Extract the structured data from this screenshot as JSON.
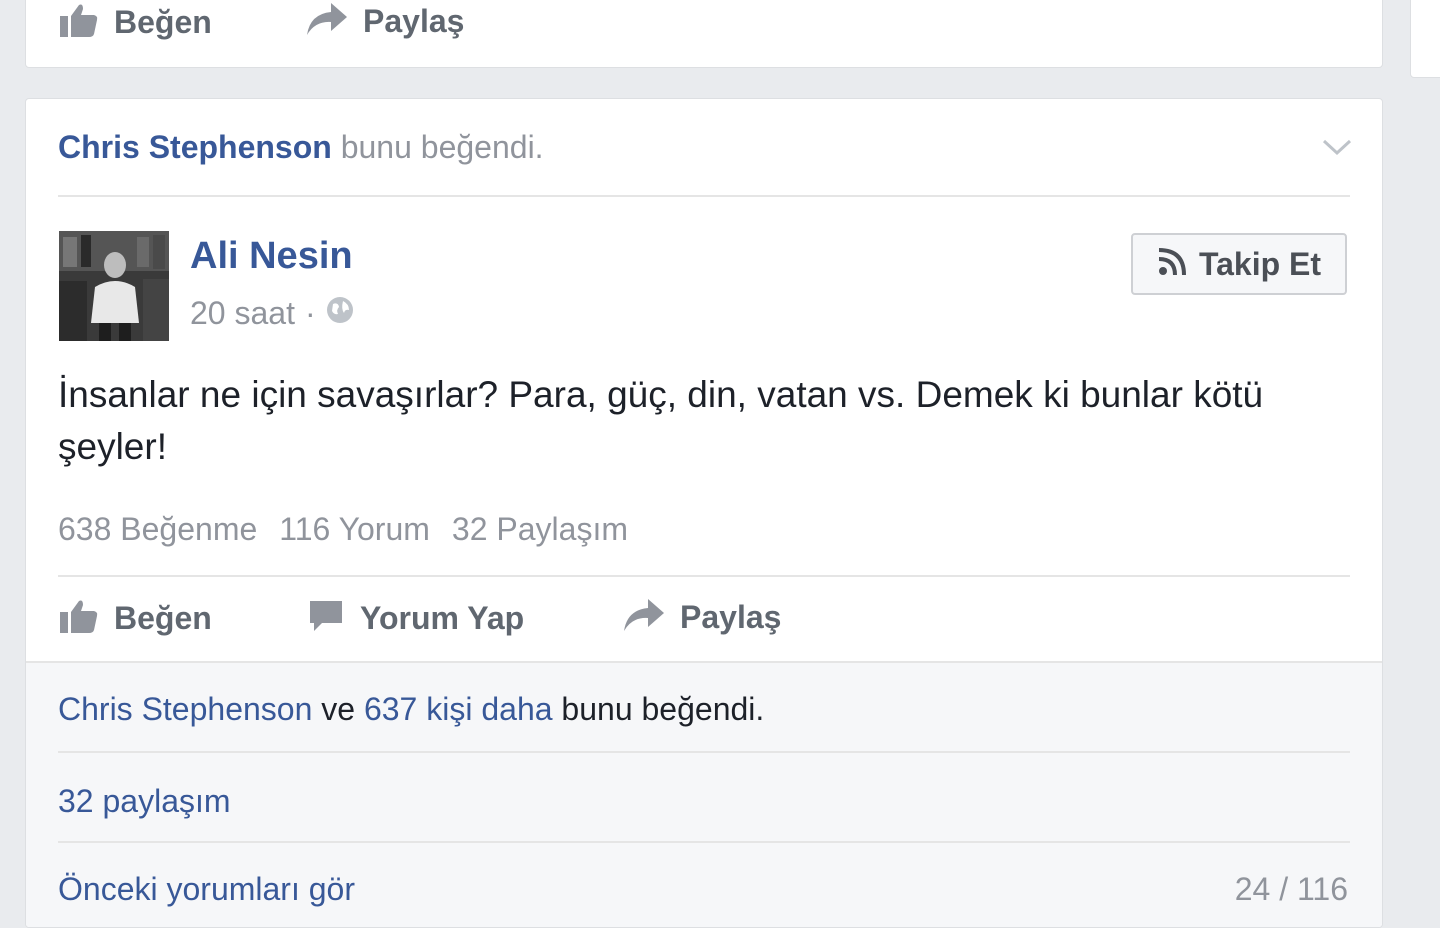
{
  "prev_post": {
    "actions": {
      "like": "Beğen",
      "share": "Paylaş"
    }
  },
  "story": {
    "actor": "Chris Stephenson",
    "activity": "bunu beğendi."
  },
  "post": {
    "author": "Ali Nesin",
    "timestamp": "20 saat",
    "separator": "·",
    "follow_label": "Takip Et",
    "text": "İnsanlar ne için savaşırlar? Para, güç, din, vatan vs. Demek ki bunlar kötü şeyler!",
    "stats": {
      "likes": "638 Beğenme",
      "comments": "116 Yorum",
      "shares": "32 Paylaşım"
    },
    "actions": {
      "like": "Beğen",
      "comment": "Yorum Yap",
      "share": "Paylaş"
    }
  },
  "feedback": {
    "liker": "Chris Stephenson",
    "conj": "ve",
    "others": "637 kişi daha",
    "suffix": "bunu beğendi.",
    "shares_link": "32 paylaşım",
    "prev_comments": "Önceki yorumları gör",
    "comment_count": "24 / 116"
  },
  "colors": {
    "link_blue": "#385898",
    "muted": "#90949c",
    "background": "#e9ebee"
  },
  "icons": [
    "like-icon",
    "share-icon",
    "comment-icon",
    "globe-icon",
    "rss-icon",
    "chevron-down-icon"
  ]
}
